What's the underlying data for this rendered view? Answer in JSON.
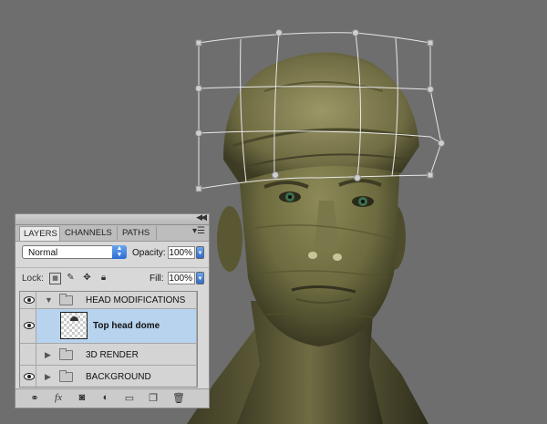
{
  "panel": {
    "tabs": [
      {
        "label": "LAYERS",
        "active": true
      },
      {
        "label": "CHANNELS",
        "active": false
      },
      {
        "label": "PATHS",
        "active": false
      }
    ],
    "blend_mode": "Normal",
    "opacity_label": "Opacity:",
    "opacity_value": "100%",
    "lock_label": "Lock:",
    "fill_label": "Fill:",
    "fill_value": "100%",
    "layers": [
      {
        "name": "HEAD MODIFICATIONS",
        "type": "group",
        "expanded": true
      },
      {
        "name": "Top head dome",
        "type": "layer",
        "selected": true
      },
      {
        "name": "3D RENDER",
        "type": "group",
        "expanded": false
      },
      {
        "name": "BACKGROUND",
        "type": "group",
        "expanded": false
      }
    ],
    "footer_icons": [
      "link-icon",
      "fx-icon",
      "mask-icon",
      "adjustment-icon",
      "new-group-icon",
      "new-layer-icon",
      "trash-icon"
    ]
  },
  "colors": {
    "canvas_background": "#6e6e6e",
    "selection_highlight": "#b7d3ee",
    "warp_grid": "#e8e8e8"
  }
}
